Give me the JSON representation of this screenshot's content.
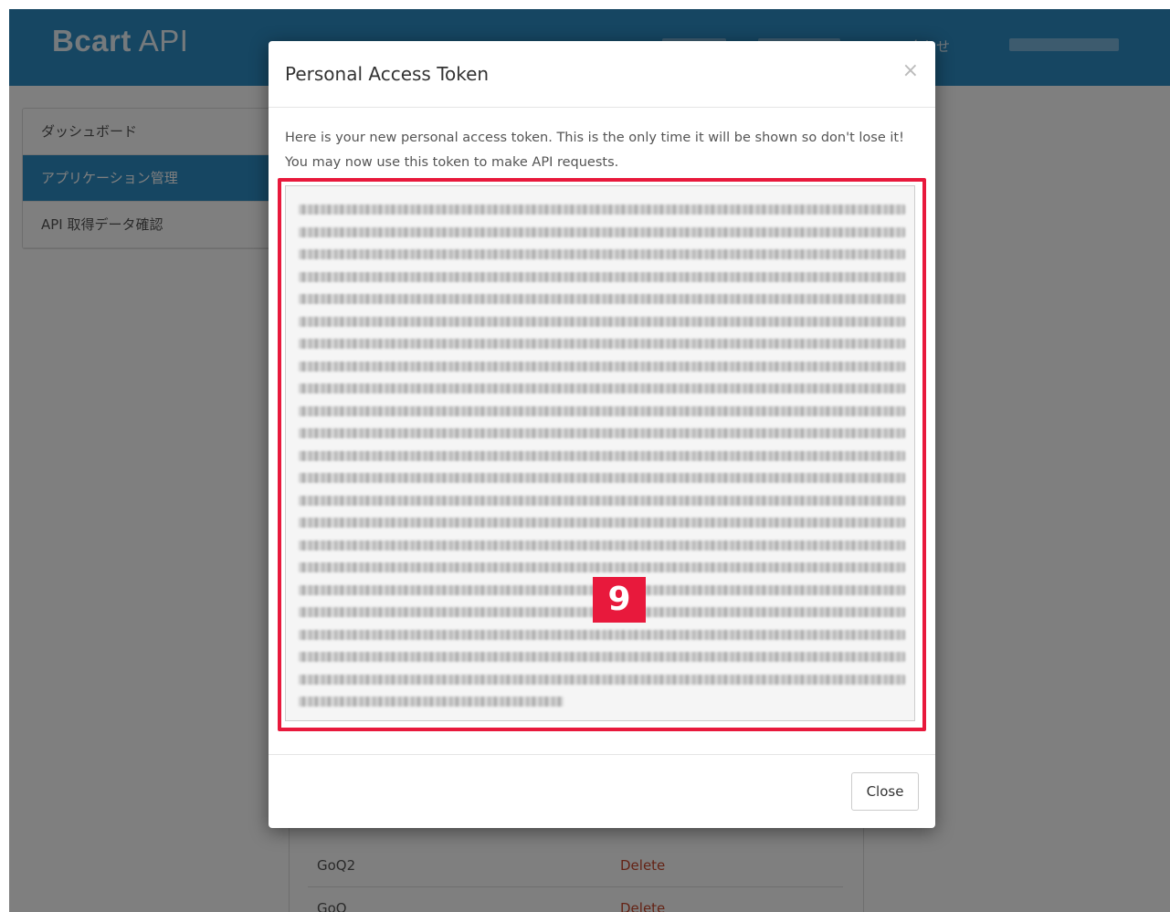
{
  "app": {
    "brand_bold": "Bcart",
    "brand_rest": "API",
    "nav_contact_fragment": "合わせ"
  },
  "sidebar": {
    "items": [
      {
        "label": "ダッシュボード",
        "active": false
      },
      {
        "label": "アプリケーション管理",
        "active": true
      },
      {
        "label": "API 取得データ確認",
        "active": false
      }
    ]
  },
  "tokens_table": {
    "rows": [
      {
        "name": "GoQ2",
        "action": "Delete"
      },
      {
        "name": "GoQ",
        "action": "Delete"
      }
    ]
  },
  "modal": {
    "title": "Personal Access Token",
    "close_icon": "×",
    "description": "Here is your new personal access token. This is the only time it will be shown so don't lose it! You may now use this token to make API requests.",
    "token_value": "(blurred token)",
    "step_badge": "9",
    "close_button": "Close"
  },
  "colors": {
    "primary": "#2d8cc4",
    "highlight": "#e8193c",
    "danger": "#c9472b"
  }
}
